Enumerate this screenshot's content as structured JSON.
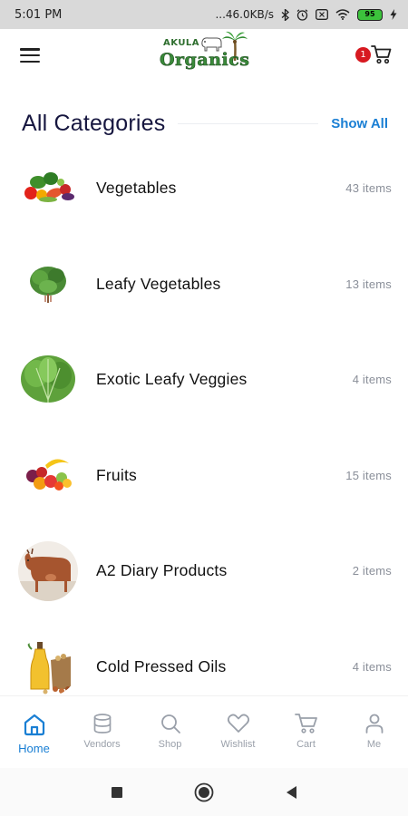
{
  "status_bar": {
    "time": "5:01 PM",
    "network_speed": "...46.0KB/s",
    "battery_level": "95",
    "icons": [
      "bluetooth-icon",
      "alarm-icon",
      "sim-icon",
      "wifi-icon",
      "battery-icon",
      "charging-icon"
    ]
  },
  "header": {
    "logo_top": "AKULA",
    "logo_main": "Organics",
    "cart_count": "1",
    "icons": {
      "menu": "menu-icon",
      "cart": "cart-icon"
    }
  },
  "section": {
    "title": "All Categories",
    "show_all": "Show All"
  },
  "categories": [
    {
      "name": "Vegetables",
      "count": "43 items"
    },
    {
      "name": "Leafy Vegetables",
      "count": "13 items"
    },
    {
      "name": "Exotic Leafy Veggies",
      "count": "4 items"
    },
    {
      "name": "Fruits",
      "count": "15 items"
    },
    {
      "name": "A2 Diary Products",
      "count": "2 items"
    },
    {
      "name": "Cold Pressed Oils",
      "count": "4 items"
    }
  ],
  "bottom_nav": {
    "active": "Home",
    "active_color": "#1a7fd4",
    "items": [
      {
        "label": "Home",
        "icon": "home-icon"
      },
      {
        "label": "Vendors",
        "icon": "database-icon"
      },
      {
        "label": "Shop",
        "icon": "search-icon"
      },
      {
        "label": "Wishlist",
        "icon": "heart-icon"
      },
      {
        "label": "Cart",
        "icon": "cart-icon"
      },
      {
        "label": "Me",
        "icon": "user-icon"
      }
    ]
  },
  "system_nav": {
    "icons": [
      "recents-icon",
      "home-circle-icon",
      "back-icon"
    ]
  }
}
